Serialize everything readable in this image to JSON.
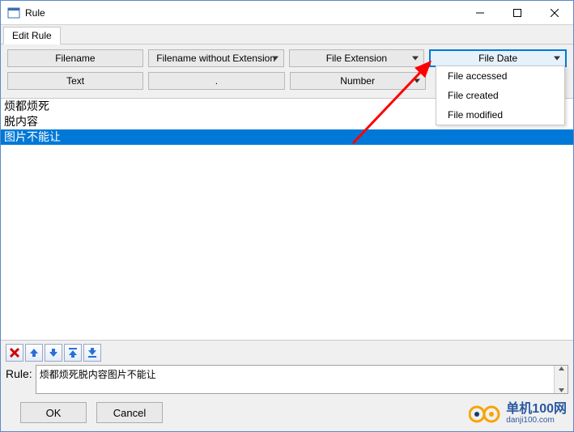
{
  "titlebar": {
    "title": "Rule"
  },
  "tab": {
    "label": "Edit Rule"
  },
  "buttons": {
    "row1": [
      {
        "label": "Filename",
        "dropdown": false
      },
      {
        "label": "Filename without Extension",
        "dropdown": true
      },
      {
        "label": "File Extension",
        "dropdown": true
      },
      {
        "label": "File Date",
        "dropdown": true,
        "active": true
      }
    ],
    "row2": [
      {
        "label": "Text",
        "dropdown": false
      },
      {
        "label": ".",
        "dropdown": false
      },
      {
        "label": "Number",
        "dropdown": true
      },
      {
        "label": "",
        "dropdown": false,
        "hidden": true
      }
    ]
  },
  "dropdown": {
    "items": [
      "File accessed",
      "File created",
      "File modified"
    ]
  },
  "list": {
    "lines": [
      {
        "text": "烦都烦死",
        "selected": false
      },
      {
        "text": "脱内容",
        "selected": false
      },
      {
        "text": "图片不能让",
        "selected": true
      }
    ]
  },
  "rule": {
    "label": "Rule:",
    "value": "烦都烦死脱内容图片不能让"
  },
  "dialog": {
    "ok": "OK",
    "cancel": "Cancel"
  },
  "watermark": {
    "zh": "单机100网",
    "en": "danji100.com"
  }
}
